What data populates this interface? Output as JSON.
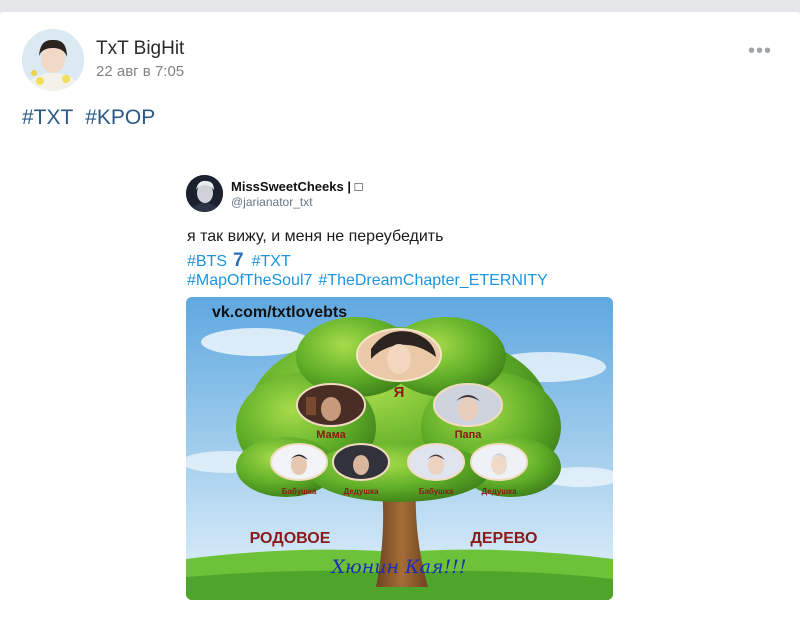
{
  "post": {
    "author": "TxT BigHit",
    "date": "22 авг в 7:05",
    "tags": [
      "#TXT",
      "#KPOP"
    ]
  },
  "tweet": {
    "name": "MissSweetCheeks | □",
    "handle": "@jarianator_txt",
    "text": "я так вижу, и меня не переубедить",
    "tags_line1": [
      "#BTS",
      "#TXT"
    ],
    "seven": "7",
    "tags_line2": [
      "#MapOfTheSoul7",
      "#TheDreamChapter_ETERNITY"
    ]
  },
  "image": {
    "watermark": "vk.com/txtlovebts",
    "labels": {
      "me": "Я",
      "mom": "Мама",
      "dad": "Папа",
      "grandma1": "Бабушка",
      "grandpa1": "Дедушка",
      "grandma2": "Бабушка",
      "grandpa2": "Дедушка"
    },
    "title_left": "РОДОВОЕ",
    "title_right": "ДЕРЕВО",
    "signature": "Хюнин Кая!!!"
  },
  "colors": {
    "link": "#2a5885",
    "twitter_blue": "#1b95e0",
    "label_red": "#8b1a1a"
  }
}
